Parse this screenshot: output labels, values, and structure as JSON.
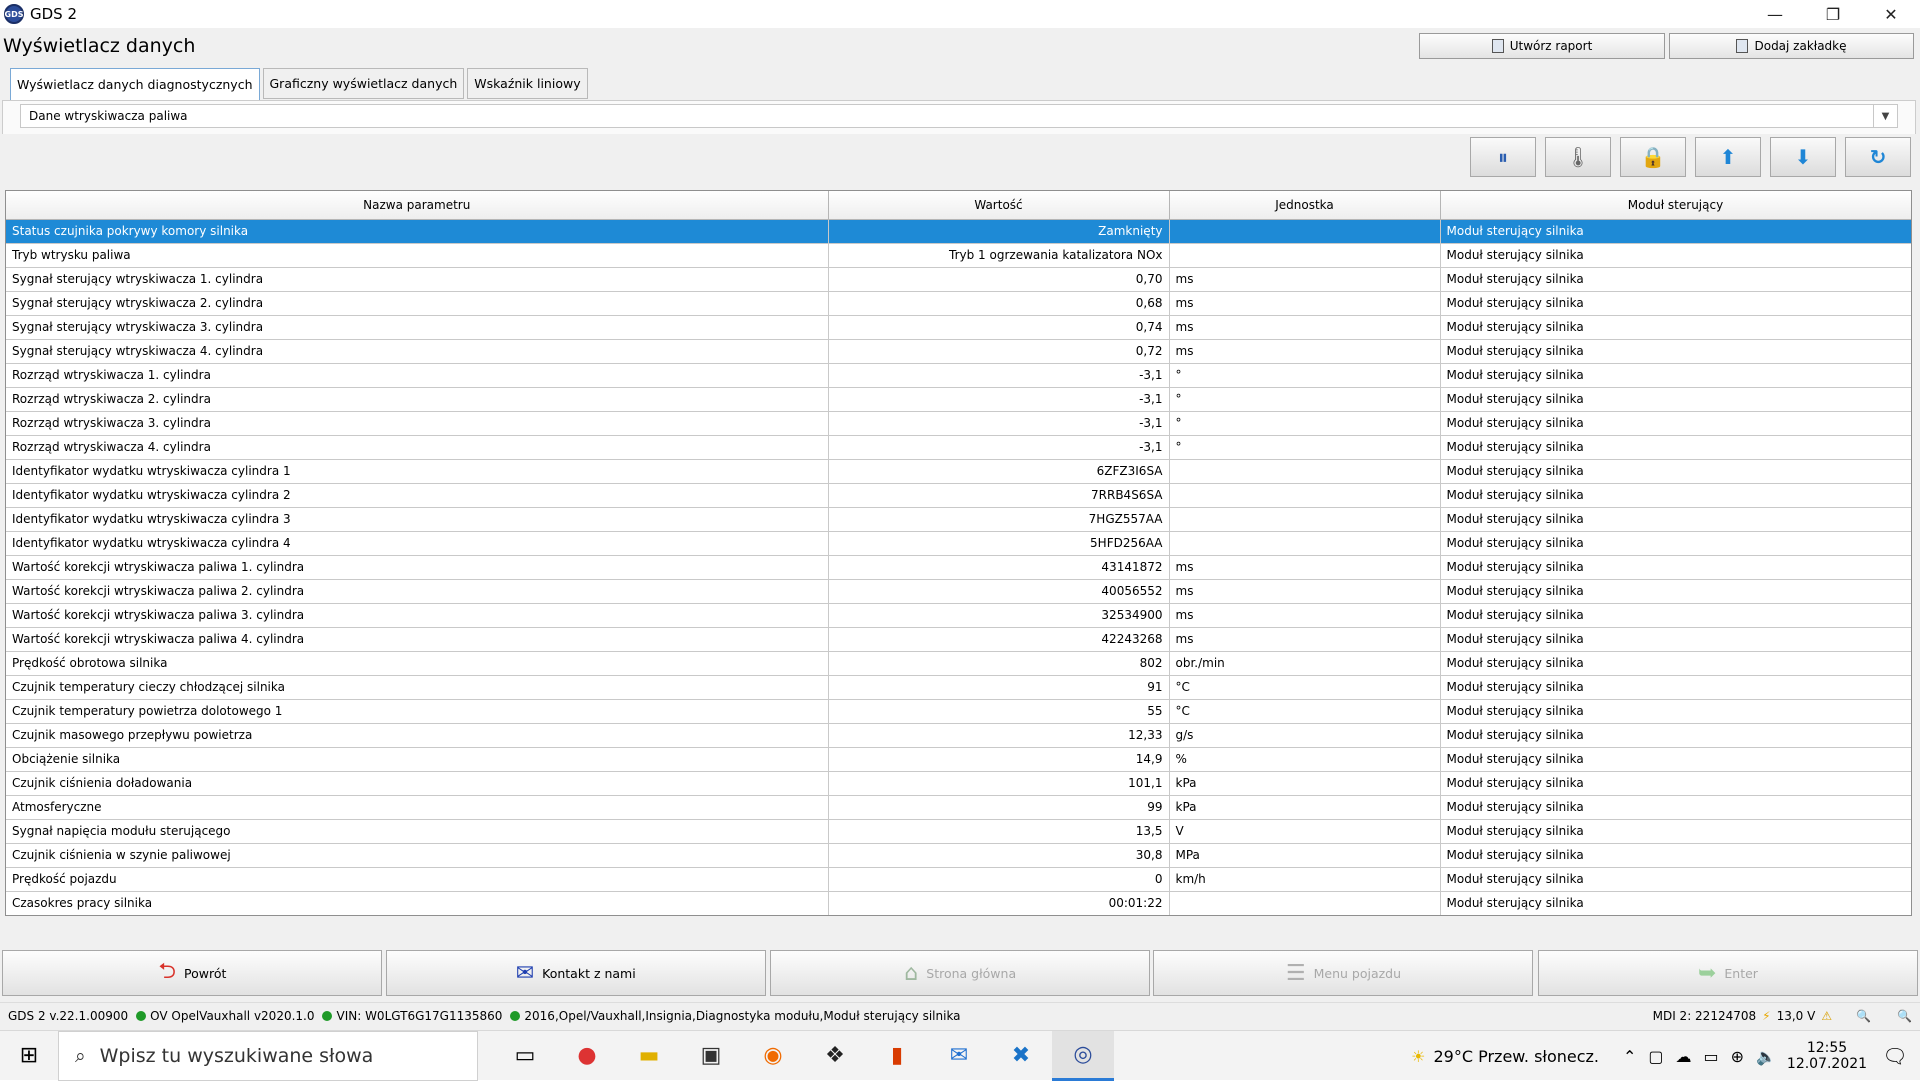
{
  "app": {
    "icon_text": "GDS",
    "title": "GDS 2"
  },
  "header": {
    "title": "Wyświetlacz danych",
    "report_button": "Utwórz raport",
    "bookmark_button": "Dodaj zakładkę"
  },
  "tabs": [
    {
      "label": "Wyświetlacz danych diagnostycznych",
      "active": true
    },
    {
      "label": "Graficzny wyświetlacz danych",
      "active": false
    },
    {
      "label": "Wskaźnik liniowy",
      "active": false
    }
  ],
  "selector": {
    "value": "Dane wtryskiwacza paliwa"
  },
  "toolbar": [
    {
      "name": "pause-icon",
      "glyph": "⏸"
    },
    {
      "name": "thermometer-icon",
      "glyph": "🌡"
    },
    {
      "name": "lock-icon",
      "glyph": "🔒"
    },
    {
      "name": "arrow-up-icon",
      "glyph": "⬆"
    },
    {
      "name": "arrow-down-icon",
      "glyph": "⬇"
    },
    {
      "name": "refresh-icon",
      "glyph": "↻"
    }
  ],
  "table": {
    "headers": [
      "Nazwa parametru",
      "Wartość",
      "Jednostka",
      "Moduł sterujący"
    ],
    "rows": [
      [
        "Status czujnika pokrywy komory silnika",
        "Zamknięty",
        "",
        "Moduł sterujący silnika"
      ],
      [
        "Tryb wtrysku paliwa",
        "Tryb 1 ogrzewania katalizatora NOx",
        "",
        "Moduł sterujący silnika"
      ],
      [
        "Sygnał sterujący wtryskiwacza 1. cylindra",
        "0,70",
        "ms",
        "Moduł sterujący silnika"
      ],
      [
        "Sygnał sterujący wtryskiwacza 2. cylindra",
        "0,68",
        "ms",
        "Moduł sterujący silnika"
      ],
      [
        "Sygnał sterujący wtryskiwacza 3. cylindra",
        "0,74",
        "ms",
        "Moduł sterujący silnika"
      ],
      [
        "Sygnał sterujący wtryskiwacza 4. cylindra",
        "0,72",
        "ms",
        "Moduł sterujący silnika"
      ],
      [
        "Rozrząd wtryskiwacza 1. cylindra",
        "-3,1",
        "°",
        "Moduł sterujący silnika"
      ],
      [
        "Rozrząd wtryskiwacza 2. cylindra",
        "-3,1",
        "°",
        "Moduł sterujący silnika"
      ],
      [
        "Rozrząd wtryskiwacza 3. cylindra",
        "-3,1",
        "°",
        "Moduł sterujący silnika"
      ],
      [
        "Rozrząd wtryskiwacza 4. cylindra",
        "-3,1",
        "°",
        "Moduł sterujący silnika"
      ],
      [
        "Identyfikator wydatku wtryskiwacza cylindra 1",
        "6ZFZ3I6SA",
        "",
        "Moduł sterujący silnika"
      ],
      [
        "Identyfikator wydatku wtryskiwacza cylindra 2",
        "7RRB4S6SA",
        "",
        "Moduł sterujący silnika"
      ],
      [
        "Identyfikator wydatku wtryskiwacza cylindra 3",
        "7HGZ557AA",
        "",
        "Moduł sterujący silnika"
      ],
      [
        "Identyfikator wydatku wtryskiwacza cylindra 4",
        "5HFD256AA",
        "",
        "Moduł sterujący silnika"
      ],
      [
        "Wartość korekcji wtryskiwacza paliwa 1. cylindra",
        "43141872",
        "ms",
        "Moduł sterujący silnika"
      ],
      [
        "Wartość korekcji wtryskiwacza paliwa 2. cylindra",
        "40056552",
        "ms",
        "Moduł sterujący silnika"
      ],
      [
        "Wartość korekcji wtryskiwacza paliwa 3. cylindra",
        "32534900",
        "ms",
        "Moduł sterujący silnika"
      ],
      [
        "Wartość korekcji wtryskiwacza paliwa 4. cylindra",
        "42243268",
        "ms",
        "Moduł sterujący silnika"
      ],
      [
        "Prędkość obrotowa silnika",
        "802",
        "obr./min",
        "Moduł sterujący silnika"
      ],
      [
        "Czujnik temperatury cieczy chłodzącej silnika",
        "91",
        "°C",
        "Moduł sterujący silnika"
      ],
      [
        "Czujnik temperatury powietrza dolotowego 1",
        "55",
        "°C",
        "Moduł sterujący silnika"
      ],
      [
        "Czujnik masowego przepływu powietrza",
        "12,33",
        "g/s",
        "Moduł sterujący silnika"
      ],
      [
        "Obciążenie silnika",
        "14,9",
        "%",
        "Moduł sterujący silnika"
      ],
      [
        "Czujnik ciśnienia doładowania",
        "101,1",
        "kPa",
        "Moduł sterujący silnika"
      ],
      [
        "Atmosferyczne",
        "99",
        "kPa",
        "Moduł sterujący silnika"
      ],
      [
        "Sygnał napięcia modułu sterującego",
        "13,5",
        "V",
        "Moduł sterujący silnika"
      ],
      [
        "Czujnik ciśnienia w szynie paliwowej",
        "30,8",
        "MPa",
        "Moduł sterujący silnika"
      ],
      [
        "Prędkość pojazdu",
        "0",
        "km/h",
        "Moduł sterujący silnika"
      ],
      [
        "Czasokres pracy silnika",
        "00:01:22",
        "",
        "Moduł sterujący silnika"
      ]
    ]
  },
  "nav": [
    {
      "label": "Powrót",
      "icon": "back-arrow-icon",
      "glyph": "⮌",
      "color": "#d8322a",
      "enabled": true
    },
    {
      "label": "Kontakt z nami",
      "icon": "envelope-icon",
      "glyph": "✉",
      "color": "#1f3fb0",
      "enabled": true
    },
    {
      "label": "Strona główna",
      "icon": "home-icon",
      "glyph": "⌂",
      "color": "#9fb8a0",
      "enabled": false
    },
    {
      "label": "Menu pojazdu",
      "icon": "vehicle-menu-icon",
      "glyph": "☰",
      "color": "#b0b0b0",
      "enabled": false
    },
    {
      "label": "Enter",
      "icon": "enter-arrow-icon",
      "glyph": "➥",
      "color": "#9cd09c",
      "enabled": false
    }
  ],
  "status": {
    "version": "GDS 2 v.22.1.00900",
    "items": [
      "OV OpelVauxhall v2020.1.0",
      "VIN: W0LGT6G17G1135860",
      "2016,Opel/Vauxhall,Insignia,Diagnostyka modułu,Moduł sterujący silnika"
    ],
    "mdi": "MDI 2: 22124708",
    "voltage": "13,0 V"
  },
  "taskbar": {
    "search_placeholder": "Wpisz tu wyszukiwane słowa",
    "weather": "29°C  Przew. słonecz.",
    "time": "12:55",
    "date": "12.07.2021"
  }
}
